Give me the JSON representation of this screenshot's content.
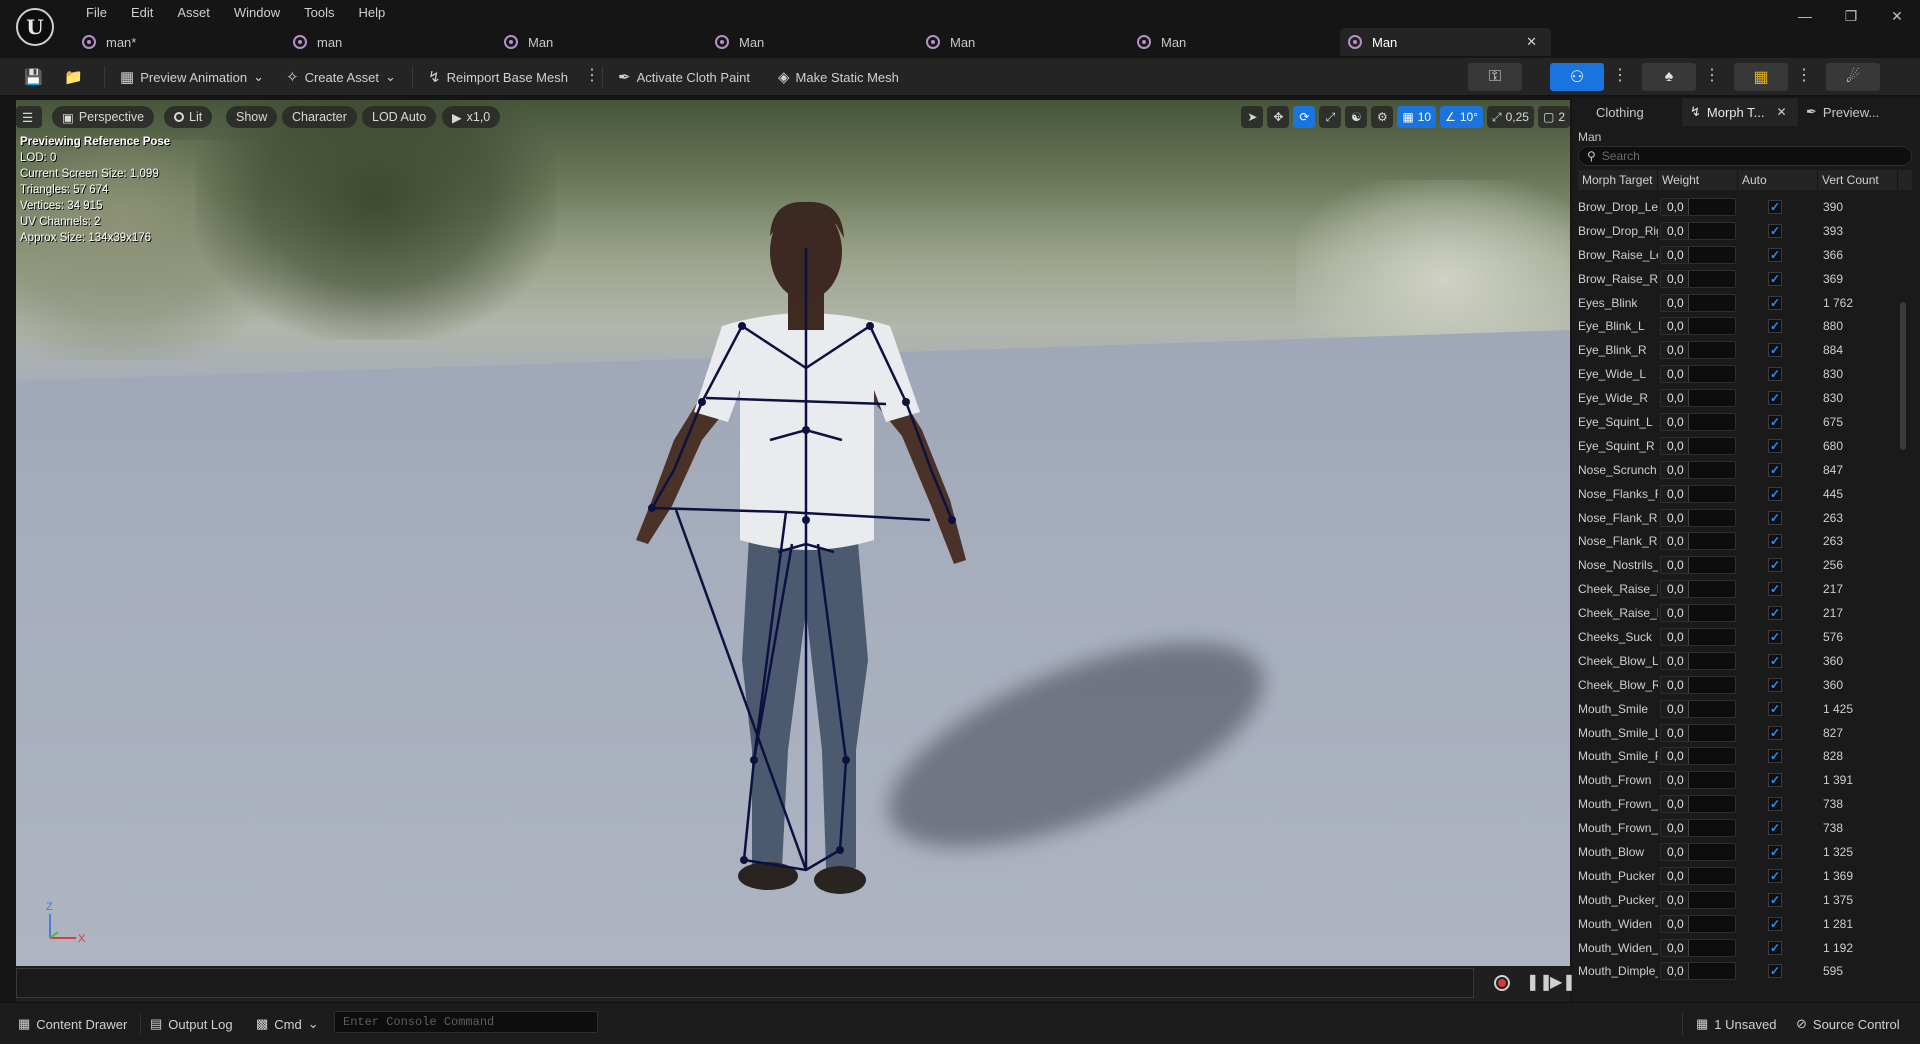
{
  "app": {
    "menu": [
      "File",
      "Edit",
      "Asset",
      "Window",
      "Tools",
      "Help"
    ],
    "tabs": [
      {
        "label": "man*",
        "active": false
      },
      {
        "label": "man",
        "active": false
      },
      {
        "label": "Man",
        "active": false
      },
      {
        "label": "Man",
        "active": false
      },
      {
        "label": "Man",
        "active": false
      },
      {
        "label": "Man",
        "active": false
      },
      {
        "label": "Man",
        "active": true
      }
    ]
  },
  "toolbar": {
    "preview_animation": "Preview Animation",
    "create_asset": "Create Asset",
    "reimport": "Reimport Base Mesh",
    "cloth_paint": "Activate Cloth Paint",
    "static_mesh": "Make Static Mesh"
  },
  "viewport": {
    "perspective": "Perspective",
    "lit": "Lit",
    "show": "Show",
    "character": "Character",
    "lod": "LOD Auto",
    "speed": "x1,0",
    "grid_snap": "10",
    "angle_snap": "10°",
    "scale_snap": "0,25",
    "camera_speed": "2",
    "stats": [
      "Previewing Reference Pose",
      "LOD: 0",
      "Current Screen Size: 1,099",
      "Triangles: 57 674",
      "Vertices: 34 915",
      "UV Channels: 2",
      "Approx Size: 134x39x176"
    ],
    "axis_z": "Z",
    "axis_x": "X"
  },
  "panel": {
    "tabs": [
      "Clothing",
      "Morph T...",
      "Preview..."
    ],
    "title": "Man",
    "search_placeholder": "Search",
    "columns": [
      "Morph Target",
      "Weight",
      "Auto",
      "Vert Count"
    ],
    "rows": [
      {
        "name": "Brow_Drop_Left",
        "weight": "0,0",
        "vert": "390"
      },
      {
        "name": "Brow_Drop_Right",
        "weight": "0,0",
        "vert": "393"
      },
      {
        "name": "Brow_Raise_Left",
        "weight": "0,0",
        "vert": "366"
      },
      {
        "name": "Brow_Raise_Right",
        "weight": "0,0",
        "vert": "369"
      },
      {
        "name": "Eyes_Blink",
        "weight": "0,0",
        "vert": "1 762"
      },
      {
        "name": "Eye_Blink_L",
        "weight": "0,0",
        "vert": "880"
      },
      {
        "name": "Eye_Blink_R",
        "weight": "0,0",
        "vert": "884"
      },
      {
        "name": "Eye_Wide_L",
        "weight": "0,0",
        "vert": "830"
      },
      {
        "name": "Eye_Wide_R",
        "weight": "0,0",
        "vert": "830"
      },
      {
        "name": "Eye_Squint_L",
        "weight": "0,0",
        "vert": "675"
      },
      {
        "name": "Eye_Squint_R",
        "weight": "0,0",
        "vert": "680"
      },
      {
        "name": "Nose_Scrunch",
        "weight": "0,0",
        "vert": "847"
      },
      {
        "name": "Nose_Flanks_Raise",
        "weight": "0,0",
        "vert": "445"
      },
      {
        "name": "Nose_Flank_Raise_L",
        "weight": "0,0",
        "vert": "263"
      },
      {
        "name": "Nose_Flank_Raise_R",
        "weight": "0,0",
        "vert": "263"
      },
      {
        "name": "Nose_Nostrils_Flare",
        "weight": "0,0",
        "vert": "256"
      },
      {
        "name": "Cheek_Raise_L",
        "weight": "0,0",
        "vert": "217"
      },
      {
        "name": "Cheek_Raise_R",
        "weight": "0,0",
        "vert": "217"
      },
      {
        "name": "Cheeks_Suck",
        "weight": "0,0",
        "vert": "576"
      },
      {
        "name": "Cheek_Blow_L",
        "weight": "0,0",
        "vert": "360"
      },
      {
        "name": "Cheek_Blow_R",
        "weight": "0,0",
        "vert": "360"
      },
      {
        "name": "Mouth_Smile",
        "weight": "0,0",
        "vert": "1 425"
      },
      {
        "name": "Mouth_Smile_L",
        "weight": "0,0",
        "vert": "827"
      },
      {
        "name": "Mouth_Smile_R",
        "weight": "0,0",
        "vert": "828"
      },
      {
        "name": "Mouth_Frown",
        "weight": "0,0",
        "vert": "1 391"
      },
      {
        "name": "Mouth_Frown_L",
        "weight": "0,0",
        "vert": "738"
      },
      {
        "name": "Mouth_Frown_R",
        "weight": "0,0",
        "vert": "738"
      },
      {
        "name": "Mouth_Blow",
        "weight": "0,0",
        "vert": "1 325"
      },
      {
        "name": "Mouth_Pucker",
        "weight": "0,0",
        "vert": "1 369"
      },
      {
        "name": "Mouth_Pucker_Open",
        "weight": "0,0",
        "vert": "1 375"
      },
      {
        "name": "Mouth_Widen",
        "weight": "0,0",
        "vert": "1 281"
      },
      {
        "name": "Mouth_Widen_Sides",
        "weight": "0,0",
        "vert": "1 192"
      },
      {
        "name": "Mouth_Dimple_L",
        "weight": "0,0",
        "vert": "595"
      }
    ]
  },
  "statusbar": {
    "content_drawer": "Content Drawer",
    "output_log": "Output Log",
    "cmd": "Cmd",
    "console_placeholder": "Enter Console Command",
    "unsaved": "1 Unsaved",
    "source_control": "Source Control"
  },
  "colors": {
    "accent": "#1a74e0",
    "check": "#2b8ef5",
    "record": "#d63a3a",
    "bone": "#0d1140"
  }
}
